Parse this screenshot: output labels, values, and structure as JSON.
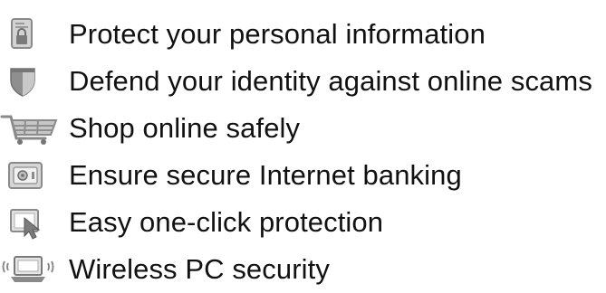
{
  "colors": {
    "text": "#111111",
    "icon_light": "#c9c9c9",
    "icon_dark": "#7a7a7a",
    "icon_mid": "#9e9e9e"
  },
  "features": [
    {
      "icon": "document-lock-icon",
      "label": "Protect your personal information"
    },
    {
      "icon": "shield-icon",
      "label": "Defend your identity against online scams"
    },
    {
      "icon": "shopping-cart-icon",
      "label": "Shop online safely"
    },
    {
      "icon": "safe-vault-icon",
      "label": "Ensure secure Internet banking"
    },
    {
      "icon": "cursor-click-icon",
      "label": "Easy one-click protection"
    },
    {
      "icon": "wireless-laptop-icon",
      "label": "Wireless PC security"
    }
  ]
}
